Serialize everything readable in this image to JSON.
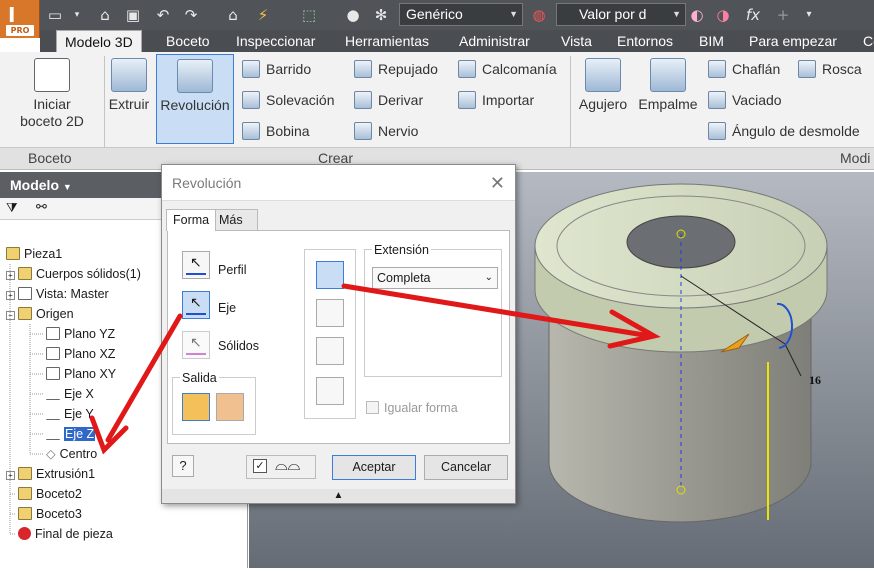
{
  "app": {
    "logo_letter": "I",
    "badge": "PRO"
  },
  "qat": {
    "material": "Genérico",
    "appearance": "Valor por d",
    "fx": "fx"
  },
  "tabs": [
    "Modelo 3D",
    "Boceto",
    "Inspeccionar",
    "Herramientas",
    "Administrar",
    "Vista",
    "Entornos",
    "BIM",
    "Para empezar",
    "Co"
  ],
  "ribbon": {
    "sketch_btn": "Iniciar\nboceto 2D",
    "extrude": "Extruir",
    "revolve": "Revolución",
    "col1": [
      "Barrido",
      "Solevación",
      "Bobina"
    ],
    "col2": [
      "Repujado",
      "Derivar",
      "Nervio"
    ],
    "col3": [
      "Calcomanía",
      "Importar"
    ],
    "hole": "Agujero",
    "fillet": "Empalme",
    "col4": [
      "Chaflán",
      "Vaciado",
      "Ángulo de desmolde"
    ],
    "col5": [
      "Rosca"
    ],
    "groups": [
      "Boceto",
      "Crear",
      "Modi"
    ]
  },
  "browser": {
    "title": "Modelo",
    "items": [
      "Pieza1",
      "Cuerpos sólidos(1)",
      "Vista: Master",
      "Origen",
      "Plano YZ",
      "Plano XZ",
      "Plano XY",
      "Eje X",
      "Eje Y",
      "Eje Z",
      "Centro",
      "Extrusión1",
      "Boceto2",
      "Boceto3",
      "Final de pieza"
    ]
  },
  "dialog": {
    "title": "Revolución",
    "tab_form": "Forma",
    "tab_more": "Más",
    "profile": "Perfil",
    "axis": "Eje",
    "solids": "Sólidos",
    "output": "Salida",
    "extent_label": "Extensión",
    "extent_value": "Completa",
    "match_shape": "Igualar forma",
    "ok": "Aceptar",
    "cancel": "Cancelar"
  },
  "viewport": {
    "dimension": "16"
  }
}
